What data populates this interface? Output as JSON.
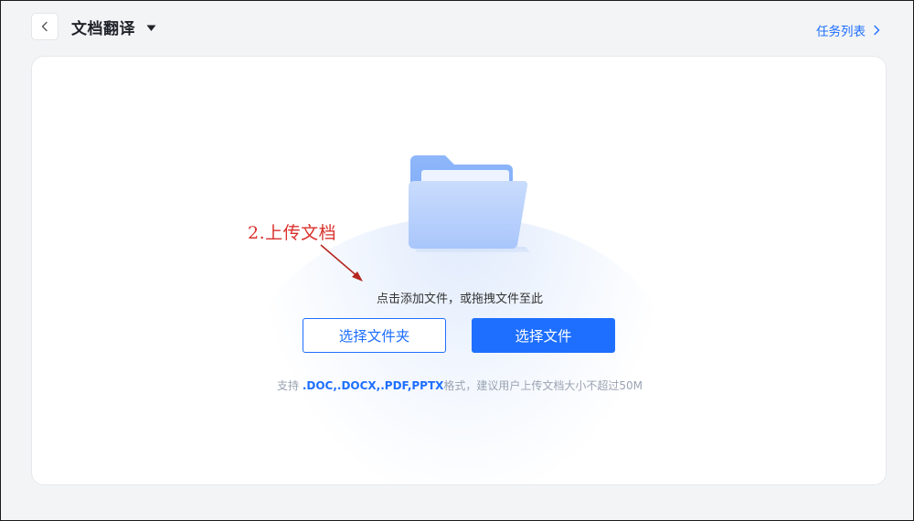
{
  "header": {
    "back_icon": "chevron-left-icon",
    "title": "文档翻译",
    "dropdown_icon": "caret-down-icon",
    "task_list_label": "任务列表",
    "task_list_icon": "chevron-right-icon"
  },
  "upload": {
    "folder_icon": "folder-icon",
    "hint": "点击添加文件，或拖拽文件至此",
    "select_folder_label": "选择文件夹",
    "select_file_label": "选择文件",
    "support_prefix": "支持",
    "support_formats": ".DOC,.DOCX,.PDF,PPTX",
    "support_suffix": "格式，建议用户上传文档大小不超过50M"
  },
  "annotation": {
    "text": "2.上传文档",
    "color": "#d9312c"
  },
  "colors": {
    "accent": "#1e6fff",
    "background": "#f3f4f6",
    "card": "#ffffff"
  }
}
